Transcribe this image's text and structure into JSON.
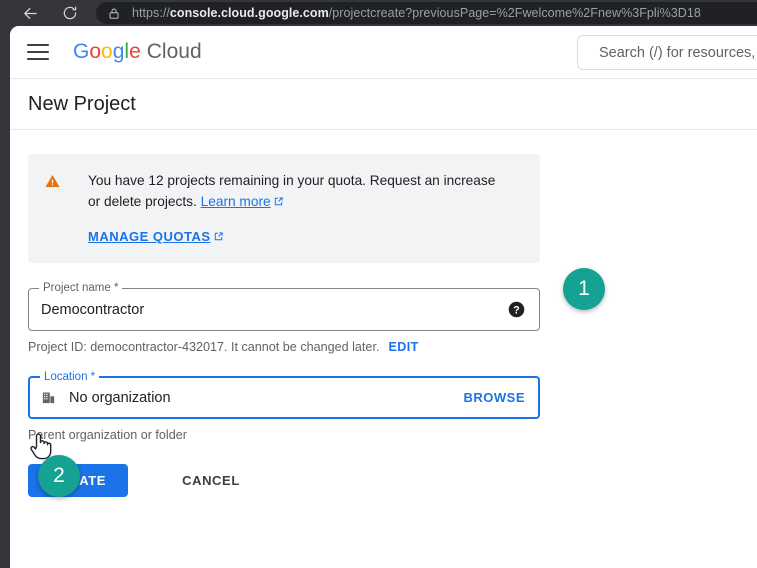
{
  "browser": {
    "back_icon": "back-arrow-icon",
    "reload_icon": "reload-icon",
    "lock_icon": "lock-icon",
    "url_scheme": "https://",
    "url_host": "console.cloud.google.com",
    "url_path": "/projectcreate?previousPage=%2Fwelcome%2Fnew%3Fpli%3D18"
  },
  "header": {
    "menu_icon": "hamburger-menu-icon",
    "logo": {
      "g1": "G",
      "o1": "o",
      "o2": "o",
      "g2": "g",
      "l1": "l",
      "e1": "e",
      "suffix": "Cloud"
    },
    "search_placeholder": "Search (/) for resources,"
  },
  "page": {
    "title": "New Project"
  },
  "notice": {
    "icon": "warning-triangle-icon",
    "text_before_link": "You have 12 projects remaining in your quota. Request an increase or delete projects.",
    "learn_more_label": "Learn more",
    "external_icon": "external-link-icon",
    "manage_quotas_label": "MANAGE QUOTAS",
    "projects_remaining": "12"
  },
  "project_name_field": {
    "label": "Project name *",
    "value": "Democontractor",
    "help_icon": "help-circle-icon",
    "helper_prefix": "Project ID: democontractor-432017. It cannot be changed later.",
    "project_id": "democontractor-432017",
    "edit_label": "EDIT"
  },
  "location_field": {
    "label": "Location *",
    "icon": "organization-building-icon",
    "value": "No organization",
    "browse_label": "BROWSE",
    "helper_text": "Parent organization or folder",
    "focused": "true"
  },
  "actions": {
    "create_label": "CREATE",
    "cancel_label": "CANCEL"
  },
  "annotations": {
    "badge_color": "#15a292",
    "items": [
      {
        "number": "1",
        "target": "project-name-field"
      },
      {
        "number": "2",
        "target": "create-button"
      }
    ]
  },
  "cursor": {
    "type": "pointing-hand-cursor"
  },
  "colors": {
    "accent_blue": "#1a73e8",
    "warning_orange": "#e37400",
    "notice_bg": "#f1f3f4",
    "chrome_dark": "#35363a",
    "omnibox_dark": "#202124"
  }
}
